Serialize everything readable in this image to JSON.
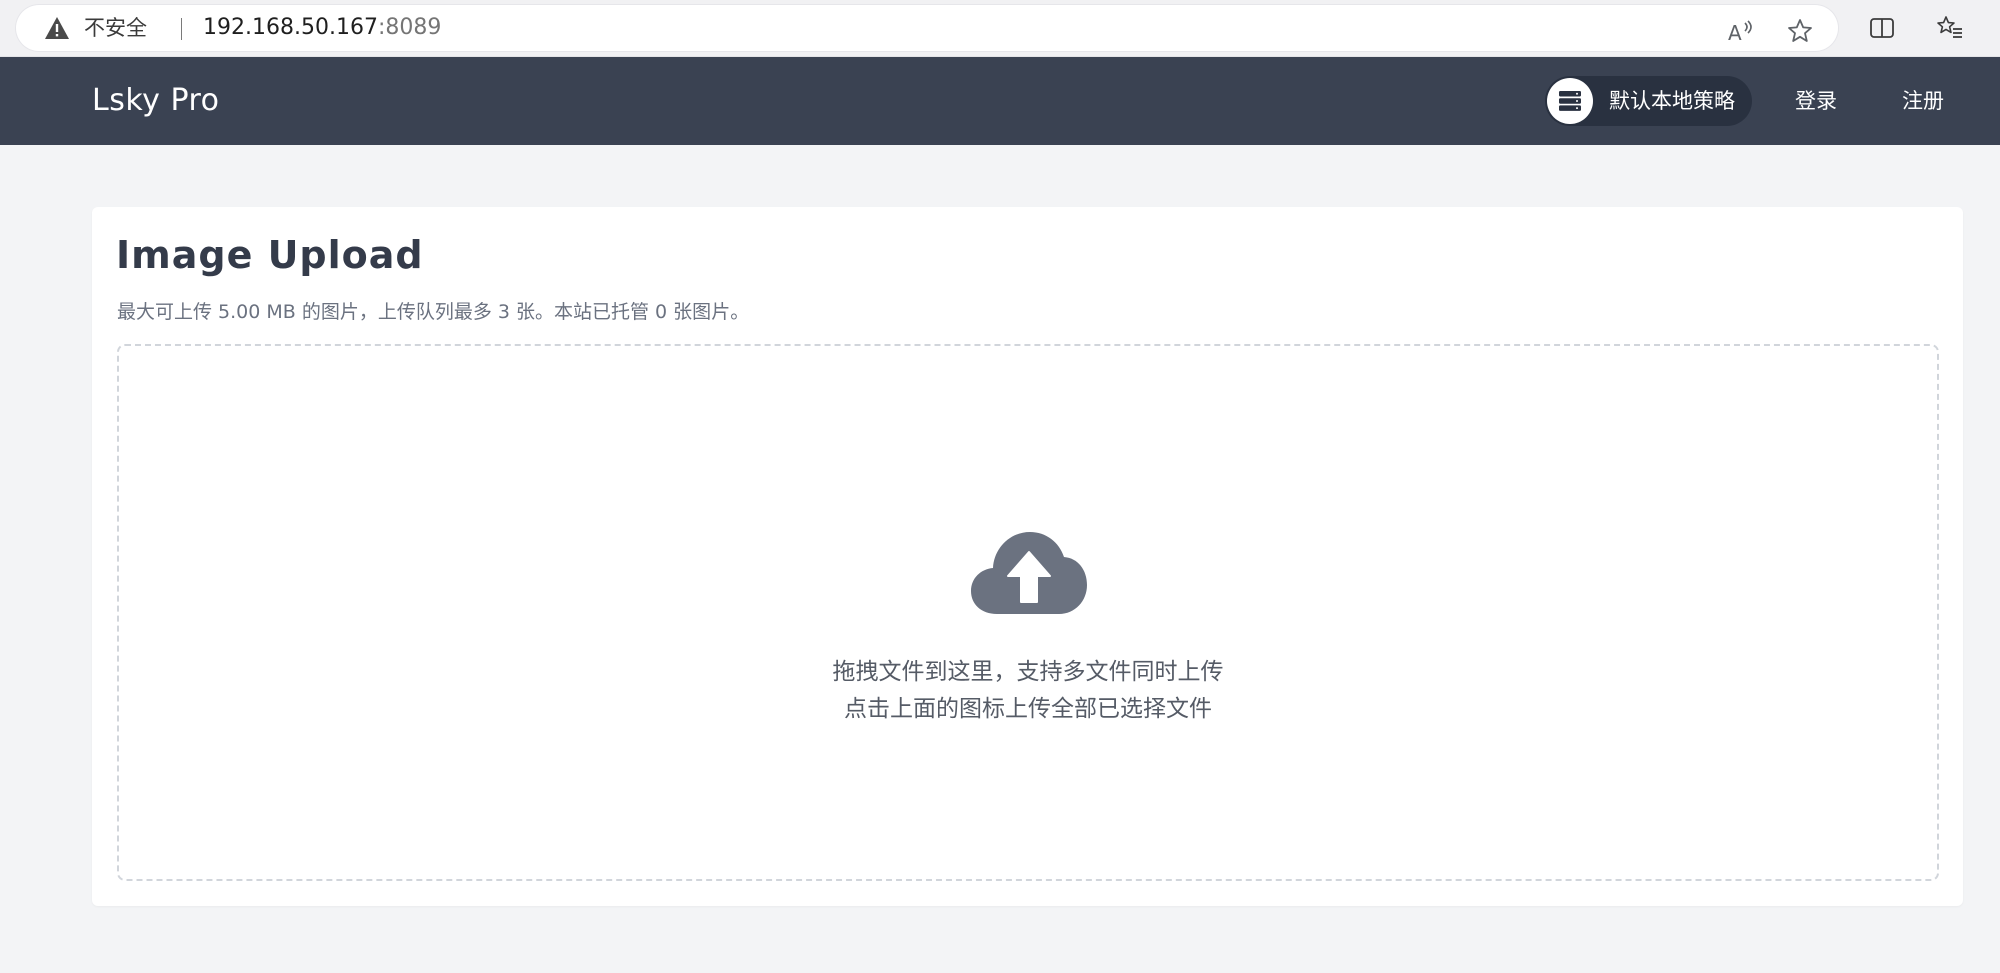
{
  "browser": {
    "security_label": "不安全",
    "url_host": "192.168.50.167",
    "url_port": ":8089",
    "icons": [
      "warning-icon",
      "read-aloud-icon",
      "favorite-star-icon",
      "split-screen-icon",
      "favorites-list-icon"
    ]
  },
  "header": {
    "brand": "Lsky Pro",
    "strategy_label": "默认本地策略",
    "strategy_icon": "server-icon",
    "login_label": "登录",
    "register_label": "注册"
  },
  "upload": {
    "title": "Image Upload",
    "subtitle": "最大可上传 5.00 MB 的图片，上传队列最多 3 张。本站已托管 0 张图片。",
    "drop_line_1": "拖拽文件到这里，支持多文件同时上传",
    "drop_line_2": "点击上面的图标上传全部已选择文件",
    "icon": "cloud-upload-icon"
  },
  "colors": {
    "header_bg": "#3a4252",
    "pill_bg": "#293140",
    "page_bg": "#f3f4f6",
    "icon_gray": "#6b7280"
  }
}
